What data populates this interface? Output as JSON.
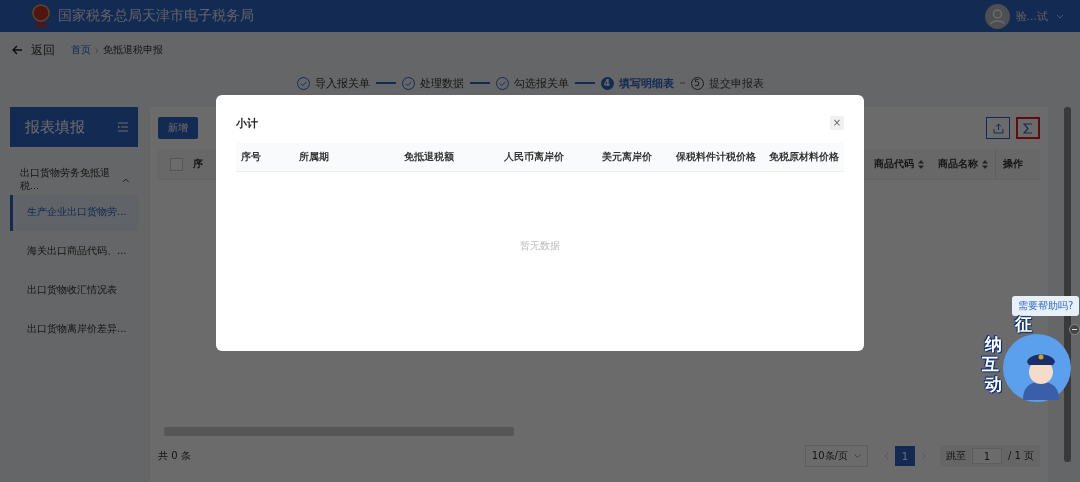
{
  "header": {
    "title": "国家税务总局天津市电子税务局",
    "user": "验...试"
  },
  "breadcrumb": {
    "back": "返回",
    "items": [
      {
        "label": "首页",
        "link": true
      },
      {
        "label": "免抵退税申报",
        "link": false
      }
    ],
    "separator": "›"
  },
  "steps": [
    {
      "label": "导入报关单",
      "completed": true,
      "selected": false
    },
    {
      "label": "处理数据",
      "completed": true,
      "selected": false
    },
    {
      "label": "勾选报关单",
      "completed": true,
      "selected": false
    },
    {
      "number": "4",
      "label": "填写明细表",
      "completed": false,
      "selected": true
    },
    {
      "number": "5",
      "label": "提交申报表",
      "completed": false,
      "selected": false
    }
  ],
  "sidebar": {
    "title": "报表填报",
    "groups": [
      {
        "label": "出口货物劳务免抵退税...",
        "expanded": true,
        "children": [
          {
            "label": "生产企业出口货物劳...",
            "selected": true
          },
          {
            "label": "海关出口商品代码、...",
            "selected": false
          },
          {
            "label": "出口货物收汇情况表",
            "selected": false
          },
          {
            "label": "出口货物离岸价差异...",
            "selected": false
          }
        ]
      }
    ]
  },
  "main": {
    "add_button": "新增",
    "summary_highlighted": true,
    "select_all_checked": false,
    "columns": [
      {
        "label": "序",
        "sortable": false,
        "kind": "left"
      },
      {
        "label": "商品代码",
        "sortable": true,
        "kind": "right"
      },
      {
        "label": "商品名称",
        "sortable": true,
        "kind": "right"
      },
      {
        "label": "操作",
        "sortable": false,
        "kind": "right"
      }
    ],
    "total": "共 0 条",
    "page_size": "10条/页",
    "pages": [
      {
        "label": "1",
        "selected": true
      }
    ],
    "jump_label": "跳至",
    "jump_value": "1",
    "page_count": "/ 1 页"
  },
  "dialog": {
    "title": "小计",
    "close": "×",
    "columns": [
      "序号",
      "所属期",
      "免抵退税额",
      "人民币离岸价",
      "美元离岸价",
      "保税料件计税价格",
      "免税原材料价格"
    ],
    "empty_text": "暂无数据"
  },
  "help": {
    "bubble": "需要帮助吗?",
    "badge_chars": [
      "征",
      "纳",
      "互",
      "动"
    ]
  }
}
